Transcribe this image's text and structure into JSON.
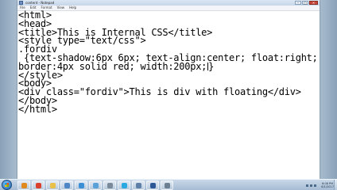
{
  "window": {
    "title": "content - Notepad",
    "controls": {
      "minimize": "–",
      "maximize": "□",
      "close": "✕"
    }
  },
  "menubar": {
    "items": [
      "File",
      "Edit",
      "Format",
      "View",
      "Help"
    ]
  },
  "editor": {
    "lines": [
      "<html>",
      "<head>",
      "<title>This is Internal CSS</title>",
      "<style type=\"text/css\">",
      ".fordiv",
      " {text-shadow:6px 6px; text-align:center; float:right;",
      "border:4px solid red; width:200px;",
      "}",
      "</style>",
      "<body>",
      "<div class=\"fordiv\">This is div with floating</div>",
      "</body>",
      "</html>"
    ],
    "line7_after_caret": "}"
  },
  "taskbar": {
    "buttons": [
      {
        "icon": "media-player-icon",
        "color": "#e08a1e"
      },
      {
        "icon": "chrome-icon",
        "color": "#d9412e"
      },
      {
        "icon": "folder-icon",
        "color": "#e8c04a"
      },
      {
        "icon": "store-icon",
        "color": "#4f86c6"
      },
      {
        "icon": "explorer-icon",
        "color": "#3a8fd6"
      },
      {
        "icon": "notepad-icon",
        "color": "#5aa0d8"
      },
      {
        "icon": "tools-icon",
        "color": "#7a8a9a"
      },
      {
        "icon": "skype-icon",
        "color": "#2aa9e0"
      },
      {
        "icon": "network-icon",
        "color": "#5e7fa8"
      },
      {
        "icon": "word-icon",
        "color": "#2b5797"
      },
      {
        "icon": "settings-icon",
        "color": "#6d7f92"
      }
    ],
    "clock": {
      "time": "6:08 PM",
      "date": "6/1/2017"
    }
  }
}
